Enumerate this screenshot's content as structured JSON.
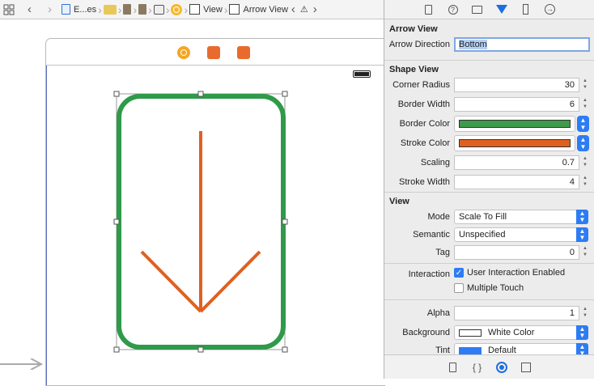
{
  "jumpbar": {
    "crumbs": [
      "E...es",
      "View",
      "Arrow View"
    ],
    "icons": [
      "grid-icon",
      "back-icon",
      "forward-icon",
      "document-icon",
      "folder-icon",
      "file-icon",
      "file-icon",
      "storyboard-icon",
      "view-controller-icon",
      "view-icon",
      "warning-icon"
    ]
  },
  "canvas": {
    "arrow_view": {
      "border_color": "#2f9a4a",
      "stroke_color": "#e0601f",
      "direction": "Bottom"
    }
  },
  "inspector": {
    "tabs": [
      "file-inspector-icon",
      "quick-help-icon",
      "identity-inspector-icon",
      "attributes-inspector-icon",
      "size-inspector-icon",
      "connections-inspector-icon"
    ],
    "arrow_view": {
      "title": "Arrow View",
      "direction_label": "Arrow Direction",
      "direction_value": "Bottom"
    },
    "shape_view": {
      "title": "Shape View",
      "corner_radius_label": "Corner Radius",
      "corner_radius": "30",
      "border_width_label": "Border Width",
      "border_width": "6",
      "border_color_label": "Border Color",
      "border_color": "#3e9b4c",
      "stroke_color_label": "Stroke Color",
      "stroke_color": "#e0601f",
      "scaling_label": "Scaling",
      "scaling": "0.7",
      "stroke_width_label": "Stroke Width",
      "stroke_width": "4"
    },
    "view": {
      "title": "View",
      "mode_label": "Mode",
      "mode": "Scale To Fill",
      "semantic_label": "Semantic",
      "semantic": "Unspecified",
      "tag_label": "Tag",
      "tag": "0",
      "interaction_label": "Interaction",
      "user_interaction": "User Interaction Enabled",
      "user_interaction_checked": true,
      "multiple_touch": "Multiple Touch",
      "multiple_touch_checked": false,
      "alpha_label": "Alpha",
      "alpha": "1",
      "background_label": "Background",
      "background": "White Color",
      "tint_label": "Tint",
      "tint": "Default"
    }
  },
  "library_tabs": [
    "file-template-icon",
    "code-snippet-icon",
    "object-library-icon",
    "media-library-icon"
  ]
}
